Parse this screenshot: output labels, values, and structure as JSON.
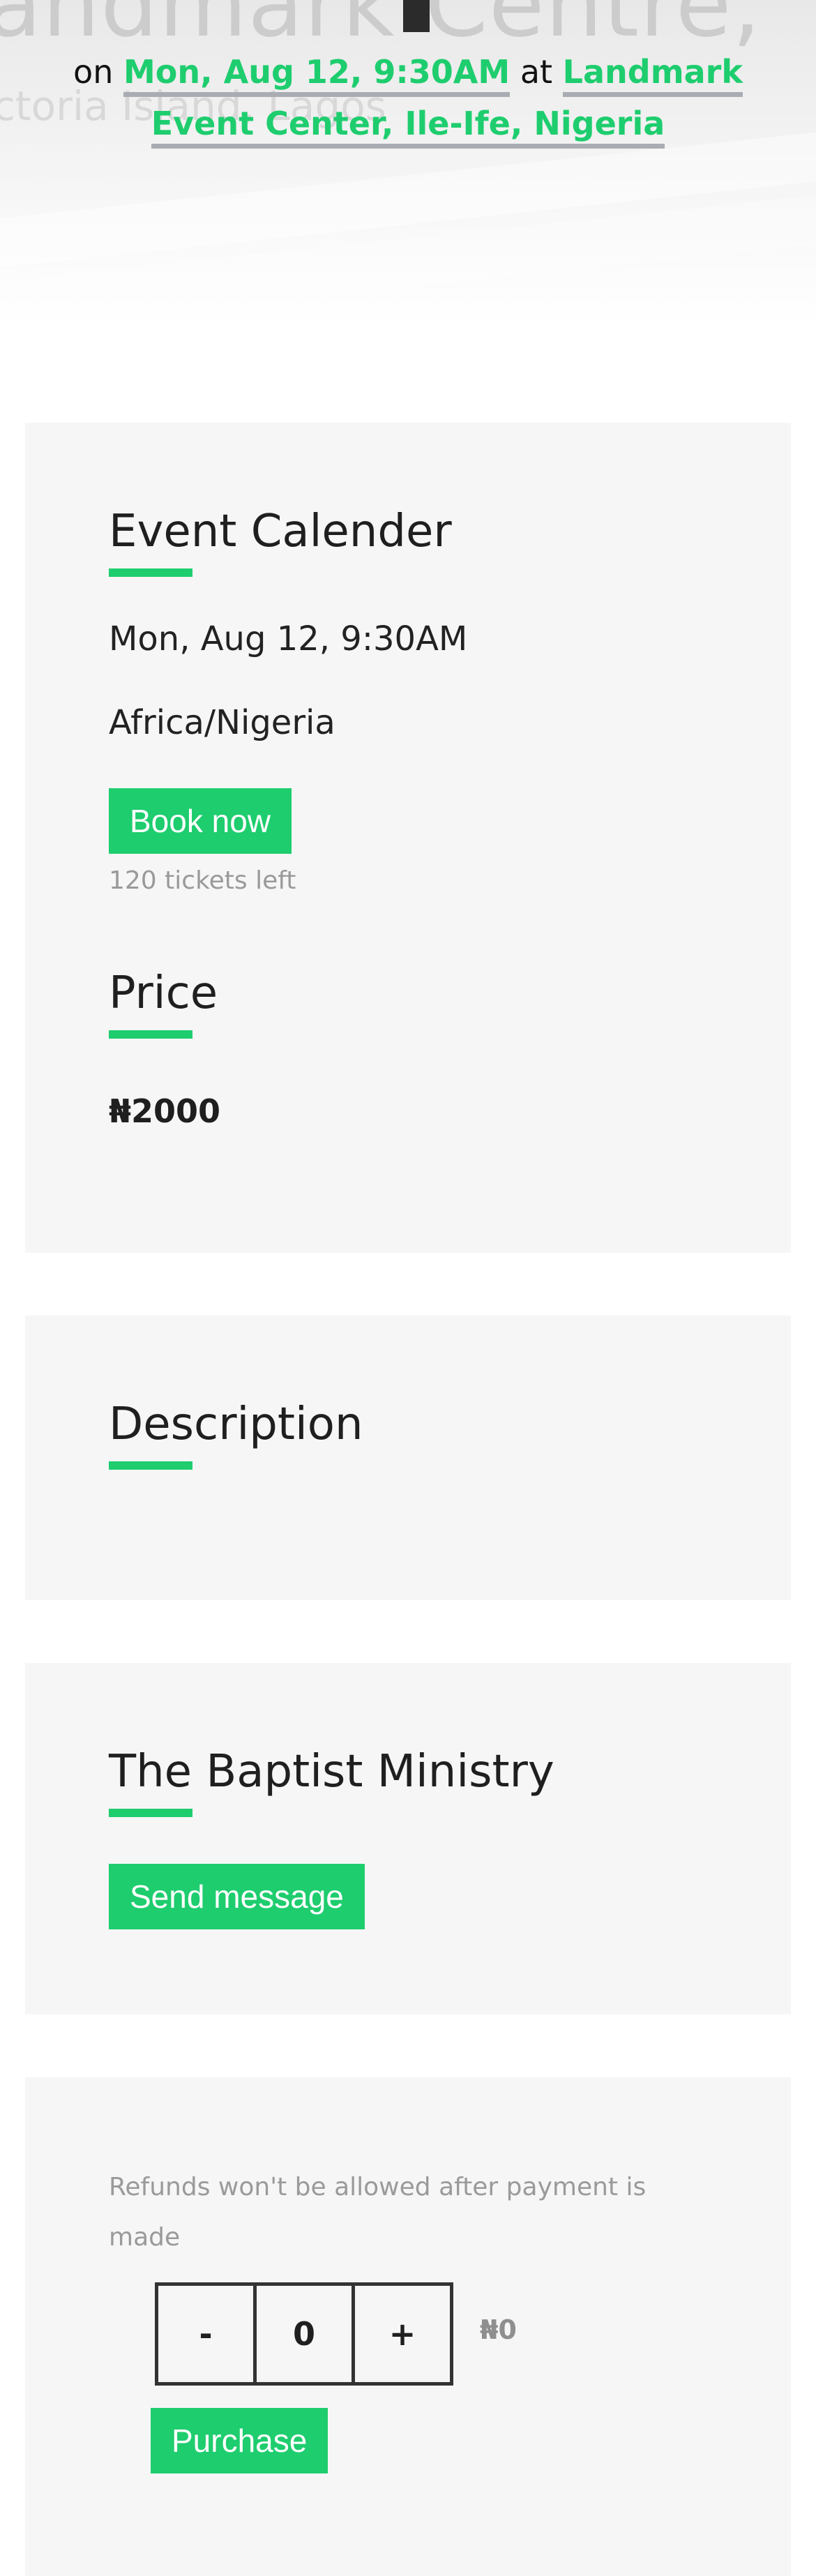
{
  "hero": {
    "bg_title": "andmark Centre,",
    "bg_subtitle": "ctoria Island, Lagos",
    "prefix": "on",
    "date_link": "Mon, Aug 12, 9:30AM",
    "connector": "at",
    "venue_link": "Landmark Event Center, Ile-Ife, Nigeria"
  },
  "calendar": {
    "heading": "Event Calender",
    "date": "Mon, Aug 12, 9:30AM",
    "timezone": "Africa/Nigeria",
    "book_label": "Book now",
    "tickets_left": "120 tickets left"
  },
  "price": {
    "heading": "Price",
    "value": "₦2000"
  },
  "description": {
    "heading": "Description"
  },
  "organizer": {
    "heading": "The Baptist Ministry",
    "message_label": "Send message"
  },
  "purchase": {
    "refund_notice": "Refunds won't be allowed after payment is made",
    "decrement_label": "-",
    "quantity": "0",
    "increment_label": "+",
    "total": "₦0",
    "purchase_label": "Purchase"
  },
  "colors": {
    "accent": "#1ecd6e",
    "card_bg": "#f6f6f6",
    "link_underline": "#a9acb2"
  }
}
